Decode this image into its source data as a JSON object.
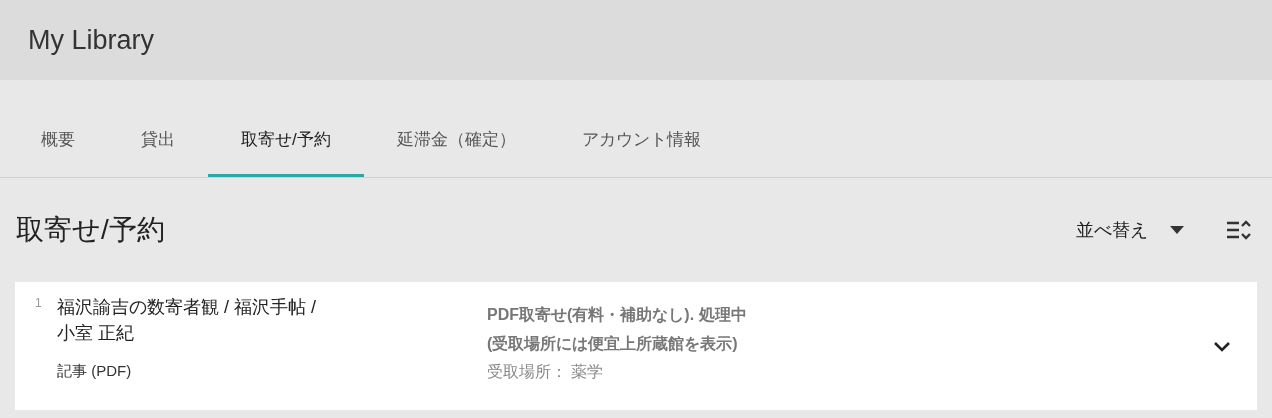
{
  "header": {
    "title": "My Library"
  },
  "tabs": [
    {
      "label": "概要",
      "selected": false
    },
    {
      "label": "貸出",
      "selected": false
    },
    {
      "label": "取寄せ/予約",
      "selected": true
    },
    {
      "label": "延滞金（確定）",
      "selected": false
    },
    {
      "label": "アカウント情報",
      "selected": false
    }
  ],
  "section": {
    "title": "取寄せ/予約",
    "sort_label": "並べ替え"
  },
  "items": [
    {
      "number": "1",
      "title": "福沢諭吉の数寄者観 / 福沢手帖 /",
      "author": "小室 正紀",
      "type": "記事 (PDF)",
      "status": "PDF取寄せ(有料・補助なし). 処理中",
      "note": "(受取場所には便宜上所蔵館を表示)",
      "pickup": "受取場所： 薬学",
      "expanded": false
    }
  ]
}
